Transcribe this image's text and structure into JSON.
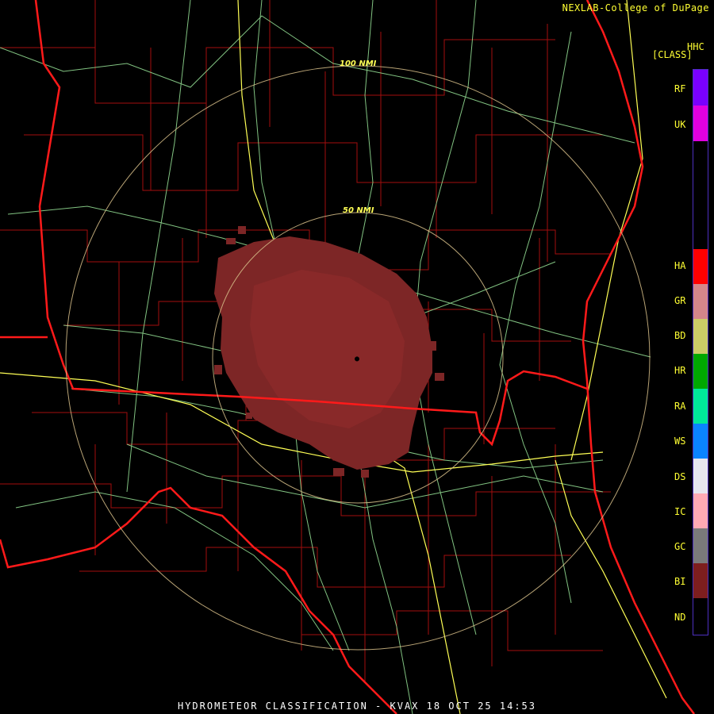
{
  "header": {
    "credit": "NEXLAB-College of DuPage",
    "product_code": "HHC",
    "product_type": "[CLASS]"
  },
  "footer": {
    "title": "HYDROMETEOR CLASSIFICATION - KVAX 18 OCT 25 14:53"
  },
  "range_rings": [
    {
      "label": "50 NMI"
    },
    {
      "label": "100 NMI"
    }
  ],
  "legend": {
    "items": [
      {
        "code": "RF",
        "color": "#7a00ff"
      },
      {
        "code": "UK",
        "color": "#e000e0"
      },
      {
        "code": "HA",
        "color": "#ff0000"
      },
      {
        "code": "GR",
        "color": "#d4868a"
      },
      {
        "code": "BD",
        "color": "#cccc66"
      },
      {
        "code": "HR",
        "color": "#00a800"
      },
      {
        "code": "RA",
        "color": "#00e89a"
      },
      {
        "code": "WS",
        "color": "#0a84ff"
      },
      {
        "code": "DS",
        "color": "#e6e6ee"
      },
      {
        "code": "IC",
        "color": "#ffaab4"
      },
      {
        "code": "GC",
        "color": "#7a7a7a"
      },
      {
        "code": "BI",
        "color": "#7d1e1e"
      },
      {
        "code": "ND",
        "color": "#000000"
      }
    ]
  },
  "colors": {
    "state_border": "#ff1a1a",
    "county_line": "#b51010",
    "highway": "#99e699",
    "interstate": "#ffff55",
    "range_ring": "#d8c08a",
    "echo": "#7d2626"
  }
}
